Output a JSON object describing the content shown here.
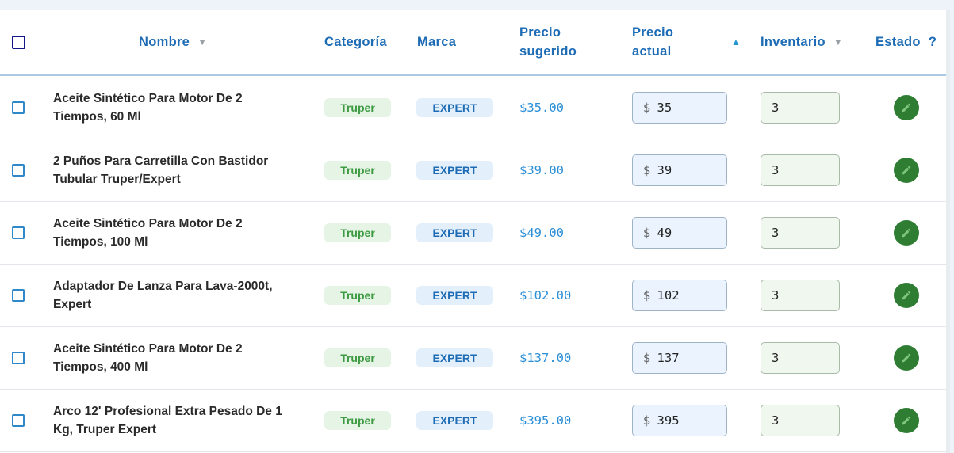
{
  "table": {
    "headers": {
      "nombre": "Nombre",
      "categoria": "Categoría",
      "marca": "Marca",
      "precio_sugerido_1": "Precio",
      "precio_sugerido_2": "sugerido",
      "precio_actual_1": "Precio",
      "precio_actual_2": "actual",
      "inventario": "Inventario",
      "estado": "Estado",
      "help": "?",
      "sort_down": "▼",
      "sort_up": "▲"
    },
    "currency_symbol": "$",
    "rows": [
      {
        "name_line1": "Aceite Sintético Para Motor De 2",
        "name_line2": "Tiempos, 60 Ml",
        "category": "Truper",
        "brand": "EXPERT",
        "suggested": "$35.00",
        "current": "35",
        "inventory": "3"
      },
      {
        "name_line1": "2 Puños Para Carretilla Con Bastidor",
        "name_line2": "Tubular Truper/Expert",
        "category": "Truper",
        "brand": "EXPERT",
        "suggested": "$39.00",
        "current": "39",
        "inventory": "3"
      },
      {
        "name_line1": "Aceite Sintético Para Motor De 2",
        "name_line2": "Tiempos, 100 Ml",
        "category": "Truper",
        "brand": "EXPERT",
        "suggested": "$49.00",
        "current": "49",
        "inventory": "3"
      },
      {
        "name_line1": "Adaptador De Lanza Para Lava-2000t,",
        "name_line2": "Expert",
        "category": "Truper",
        "brand": "EXPERT",
        "suggested": "$102.00",
        "current": "102",
        "inventory": "3"
      },
      {
        "name_line1": "Aceite Sintético Para Motor De 2",
        "name_line2": "Tiempos, 400 Ml",
        "category": "Truper",
        "brand": "EXPERT",
        "suggested": "$137.00",
        "current": "137",
        "inventory": "3"
      },
      {
        "name_line1": "Arco 12' Profesional Extra Pesado De 1",
        "name_line2": "Kg, Truper Expert",
        "category": "Truper",
        "brand": "EXPERT",
        "suggested": "$395.00",
        "current": "395",
        "inventory": "3"
      }
    ]
  },
  "icons": {
    "edit": "pencil-icon",
    "sort": "sort-arrow-icon",
    "checkbox": "checkbox-icon"
  },
  "colors": {
    "header_text": "#1d6cb5",
    "category_badge": "#e6f4e6",
    "brand_badge": "#e3f0fb",
    "edit_button": "#2e7d32",
    "suggested_price": "#2b8fd6"
  }
}
